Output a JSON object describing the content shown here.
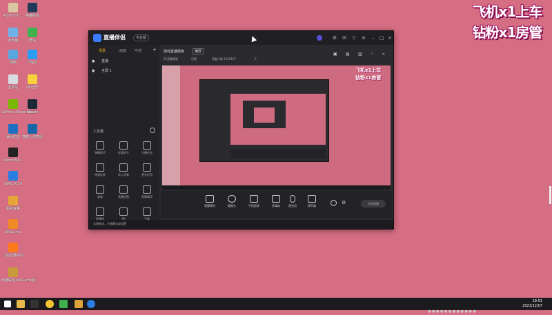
{
  "desktop": {
    "icons": [
      {
        "label": "Administr...",
        "color": "#d9c7a1"
      },
      {
        "label": "此电脑",
        "color": "#6fb2e8"
      },
      {
        "label": "网络",
        "color": "#5aa6e0"
      },
      {
        "label": "回收站",
        "color": "#d7dce0"
      },
      {
        "label": "GeForce Experience",
        "color": "#7ab800"
      },
      {
        "label": "暴风影音",
        "color": "#1d6fc2"
      },
      {
        "label": "MicroKMS...",
        "color": "#222222"
      },
      {
        "label": "WPS 2019",
        "color": "#2a7de1"
      },
      {
        "label": "超级变量",
        "color": "#e6a637"
      },
      {
        "label": "WeGame",
        "color": "#f08a24"
      },
      {
        "label": "斗鱼直播伴侣",
        "color": "#ff7a1a"
      },
      {
        "label": "英雄联盟 WeGame版",
        "color": "#c79a3a"
      },
      {
        "label": "英雄联盟",
        "color": "#203a5c"
      },
      {
        "label": "微信",
        "color": "#3fb24d"
      },
      {
        "label": "IT信息",
        "color": "#2a9df4"
      },
      {
        "label": "QQ音乐",
        "color": "#f7d23a"
      },
      {
        "label": "Steam",
        "color": "#1b2838"
      },
      {
        "label": "穿越火线高清",
        "color": "#1366a8"
      }
    ]
  },
  "banner": {
    "line1": "飞机x1上车",
    "line2": "钻粉x1房管"
  },
  "app": {
    "name": "直播伴侣",
    "version": "专业版",
    "sidebar_tabs": [
      "场景",
      "画面",
      "可选"
    ],
    "scenes": [
      "直播",
      "全屏 1"
    ],
    "toolbox_label": "工具箱",
    "tools": [
      "弹幕助手",
      "房管助手",
      "主播任务",
      "视频连麦",
      "导入场景",
      "更多应用",
      "录像",
      "直播设置",
      "直播事项",
      "直播间",
      "PK",
      "下载"
    ],
    "header_tabs": [
      "游戏直播模板",
      "横屏"
    ],
    "header_sub": [
      "52直播模板",
      "设置",
      "观看人数 1540157",
      "0"
    ],
    "bottom_buttons": [
      "直播预览",
      "摄像头",
      "手机投屏",
      "多媒体",
      "麦克风",
      "扬声器"
    ],
    "start_label": "开始直播",
    "status_text": "本地推流，已隐藏全部设置"
  },
  "taskbar": {
    "time": "19:51",
    "date": "2021/12/07"
  }
}
